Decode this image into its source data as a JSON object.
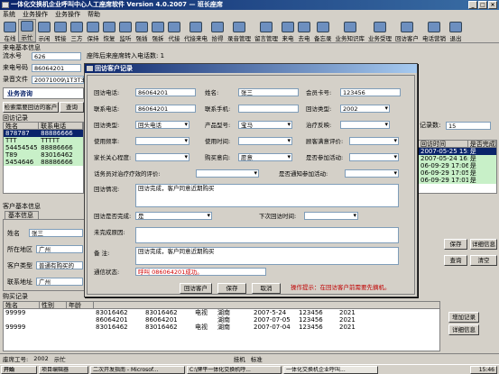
{
  "app": {
    "title": "一体化交换机企业呼叫中心人工座席软件 Version 4.0.2007 — 班长座席"
  },
  "menu": [
    "系统",
    "业务操作",
    "业务操作",
    "帮助"
  ],
  "toolbar": [
    "在线",
    "示忙",
    "示闲",
    "转接",
    "三方",
    "保持",
    "恢复",
    "监听",
    "强插",
    "强拆",
    "代接",
    "代接来电",
    "拾得",
    "录音管理",
    "留言管理",
    "来电",
    "去电",
    "备忘录",
    "业务知识库",
    "业务受理",
    "回访客户",
    "电话营销",
    "退出"
  ],
  "left": {
    "section_title": "来电基本信息",
    "fields": [
      {
        "label": "流水号",
        "value": "626"
      },
      {
        "label": "来电号码",
        "value": "86064201"
      },
      {
        "label": "录音文件",
        "value": "20071009\\1T3T39.62"
      }
    ],
    "waiting_text": "座阵后来座席转入电话数: 1",
    "tab_label": "业务咨询",
    "tab2_label": "投诉",
    "buttons": [
      "检索需要回访的客户",
      "查询"
    ],
    "visit_section": "回访记录",
    "visit_headers": [
      "姓名",
      "联系电话"
    ],
    "visit_rows": [
      [
        "878787",
        "88886666"
      ],
      [
        "TTT",
        "TTTTT"
      ],
      [
        "54454545",
        "88886666"
      ],
      [
        "T89",
        "83016462"
      ],
      [
        "5454646",
        "88886666"
      ]
    ],
    "customer_section": "客户基本信息",
    "customer_tab": "基本信息",
    "customer_fields": [
      {
        "label": "姓名",
        "value": "张三"
      },
      {
        "label": "所在地区",
        "value": "广州"
      },
      {
        "label": "客户类型",
        "value": "普通有购买的"
      },
      {
        "label": "联系地址",
        "value": "广州"
      }
    ]
  },
  "right": {
    "count_label": "记录数:",
    "count_value": "15",
    "headers": [
      "回访时间",
      "是否完成"
    ],
    "rows": [
      [
        "2007-05-25 15:0",
        "是"
      ],
      [
        "2007-05-24 16:11",
        "是"
      ],
      [
        "06-09-29 17:06",
        "是"
      ],
      [
        "06-09-29 17:05",
        "是"
      ],
      [
        "06-09-29 17:01",
        "是"
      ]
    ],
    "buttons": [
      "保存",
      "详细信息",
      "查询",
      "清空"
    ]
  },
  "purchase": {
    "section": "购买记录",
    "headers": [
      "姓名",
      "性别",
      "年龄"
    ],
    "rows": [
      [
        "99999",
        "",
        "",
        "83016462",
        "83016462",
        "电视",
        "湖南",
        "2007-5-24",
        "123456",
        "2021"
      ],
      [
        "",
        "",
        "",
        "86064201",
        "86064201",
        "",
        "湖南",
        "2007-07-05",
        "123456",
        "2021"
      ],
      [
        "99999",
        "",
        "",
        "83016462",
        "83016462",
        "电视",
        "湖南",
        "2007-07-04",
        "123456",
        "2021"
      ]
    ],
    "buttons": [
      "增加记录",
      "详细信息"
    ]
  },
  "dialog": {
    "title": "回访客户记录",
    "call_phone_label": "回访电话:",
    "call_phone": "86064201",
    "name_label": "姓名:",
    "name": "张三",
    "member_label": "会员卡号:",
    "member": "123456",
    "contact_label": "联系电话:",
    "contact": "86064201",
    "contact2_label": "联系手机:",
    "contact2": "",
    "visit_type_label": "回访类型:",
    "visit_type": "2002",
    "call_type_label": "回访类型:",
    "call_type": "回头电话",
    "product_label": "产品型号:",
    "product": "宝马",
    "effect_label": "治疗反映:",
    "use_freq_label": "使用频率:",
    "use_time_label": "使用时间:",
    "satisfy_label": "顾客满意评价:",
    "family_label": "家长关心程度:",
    "buy_label": "购买意向:",
    "buy_value": "愿意",
    "activity_label": "是否参加活动:",
    "doctor_label": "话务员对治疗疗效的评价:",
    "join_label": "是否通知参加活动:",
    "situation_label": "回访情况:",
    "situation": "回访完成，客户同意近期购买",
    "finished_label": "回访是否完成:",
    "finished": "是",
    "next_label": "下次回访时间:",
    "reason_label": "未完成原因:",
    "note_label": "备    注:",
    "note": "回访完成，客户同意近期购买",
    "status_label": "通信状态:",
    "status": "呼叫 086064201成功。",
    "buttons": [
      "回访客户",
      "保存",
      "取消"
    ],
    "hint": "操作提示：在回访客户前需要先摘机。"
  },
  "statusbar": {
    "agent_label": "座席工号:",
    "agent": "2002",
    "state": "示忙",
    "hangup": "挂机",
    "std": "标准"
  },
  "taskbar": {
    "start": "开始",
    "items": [
      "项目编辑器",
      "二次开发指南 - Microsof...",
      "C:\\牌平一体化交换机呼...",
      "一体化交换机企业呼叫..."
    ],
    "time": "15:46"
  }
}
